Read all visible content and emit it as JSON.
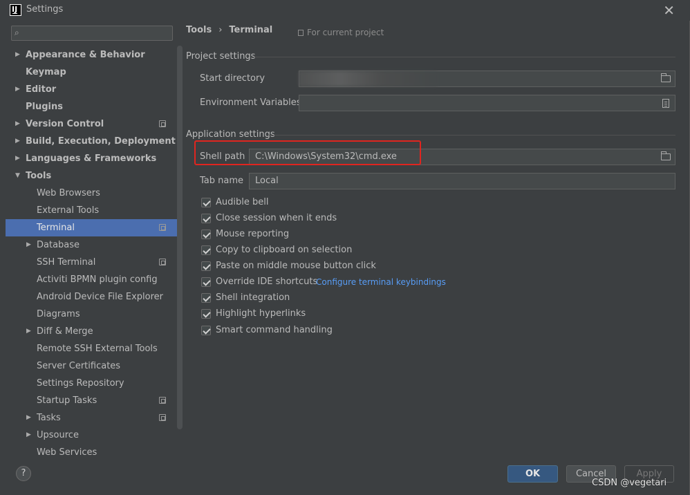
{
  "window": {
    "title": "Settings",
    "app_icon_text": "IJ"
  },
  "search": {
    "placeholder": ""
  },
  "sidebar": {
    "items": [
      {
        "label": "Appearance & Behavior",
        "level": 0,
        "arrow": "right",
        "badge": false,
        "selected": false
      },
      {
        "label": "Keymap",
        "level": 0,
        "arrow": "",
        "badge": false,
        "selected": false
      },
      {
        "label": "Editor",
        "level": 0,
        "arrow": "right",
        "badge": false,
        "selected": false
      },
      {
        "label": "Plugins",
        "level": 0,
        "arrow": "",
        "badge": false,
        "selected": false
      },
      {
        "label": "Version Control",
        "level": 0,
        "arrow": "right",
        "badge": true,
        "selected": false
      },
      {
        "label": "Build, Execution, Deployment",
        "level": 0,
        "arrow": "right",
        "badge": false,
        "selected": false
      },
      {
        "label": "Languages & Frameworks",
        "level": 0,
        "arrow": "right",
        "badge": false,
        "selected": false
      },
      {
        "label": "Tools",
        "level": 0,
        "arrow": "down",
        "badge": false,
        "selected": false
      },
      {
        "label": "Web Browsers",
        "level": 1,
        "arrow": "",
        "badge": false,
        "selected": false
      },
      {
        "label": "External Tools",
        "level": 1,
        "arrow": "",
        "badge": false,
        "selected": false
      },
      {
        "label": "Terminal",
        "level": 1,
        "arrow": "",
        "badge": true,
        "selected": true
      },
      {
        "label": "Database",
        "level": 1,
        "arrow": "right",
        "badge": false,
        "selected": false
      },
      {
        "label": "SSH Terminal",
        "level": 1,
        "arrow": "",
        "badge": true,
        "selected": false
      },
      {
        "label": "Activiti BPMN plugin config",
        "level": 1,
        "arrow": "",
        "badge": false,
        "selected": false
      },
      {
        "label": "Android Device File Explorer",
        "level": 1,
        "arrow": "",
        "badge": false,
        "selected": false
      },
      {
        "label": "Diagrams",
        "level": 1,
        "arrow": "",
        "badge": false,
        "selected": false
      },
      {
        "label": "Diff & Merge",
        "level": 1,
        "arrow": "right",
        "badge": false,
        "selected": false
      },
      {
        "label": "Remote SSH External Tools",
        "level": 1,
        "arrow": "",
        "badge": false,
        "selected": false
      },
      {
        "label": "Server Certificates",
        "level": 1,
        "arrow": "",
        "badge": false,
        "selected": false
      },
      {
        "label": "Settings Repository",
        "level": 1,
        "arrow": "",
        "badge": false,
        "selected": false
      },
      {
        "label": "Startup Tasks",
        "level": 1,
        "arrow": "",
        "badge": true,
        "selected": false
      },
      {
        "label": "Tasks",
        "level": 1,
        "arrow": "right",
        "badge": true,
        "selected": false
      },
      {
        "label": "Upsource",
        "level": 1,
        "arrow": "right",
        "badge": false,
        "selected": false
      },
      {
        "label": "Web Services",
        "level": 1,
        "arrow": "",
        "badge": false,
        "selected": false
      }
    ]
  },
  "breadcrumb": {
    "parent": "Tools",
    "separator": "›",
    "current": "Terminal"
  },
  "scope_note": "For current project",
  "project_settings": {
    "heading": "Project settings",
    "start_directory_label": "Start directory",
    "start_directory_value": "",
    "env_vars_label": "Environment Variables",
    "env_vars_value": ""
  },
  "app_settings": {
    "heading": "Application settings",
    "shell_path_label": "Shell path",
    "shell_path_value": "C:\\Windows\\System32\\cmd.exe",
    "tab_name_label": "Tab name",
    "tab_name_value": "Local",
    "checkboxes": [
      {
        "label": "Audible bell",
        "checked": true
      },
      {
        "label": "Close session when it ends",
        "checked": true
      },
      {
        "label": "Mouse reporting",
        "checked": true
      },
      {
        "label": "Copy to clipboard on selection",
        "checked": true
      },
      {
        "label": "Paste on middle mouse button click",
        "checked": true
      },
      {
        "label": "Override IDE shortcuts",
        "checked": true
      },
      {
        "label": "Shell integration",
        "checked": true
      },
      {
        "label": "Highlight hyperlinks",
        "checked": true
      },
      {
        "label": "Smart command handling",
        "checked": true
      }
    ],
    "keybindings_link": "Configure terminal keybindings"
  },
  "buttons": {
    "help": "?",
    "ok": "OK",
    "cancel": "Cancel",
    "apply": "Apply"
  },
  "watermark": "CSDN @vegetari",
  "colors": {
    "selection": "#4b6eaf",
    "highlight_box": "#e0251f",
    "link": "#589df6",
    "ok_button": "#365880"
  }
}
